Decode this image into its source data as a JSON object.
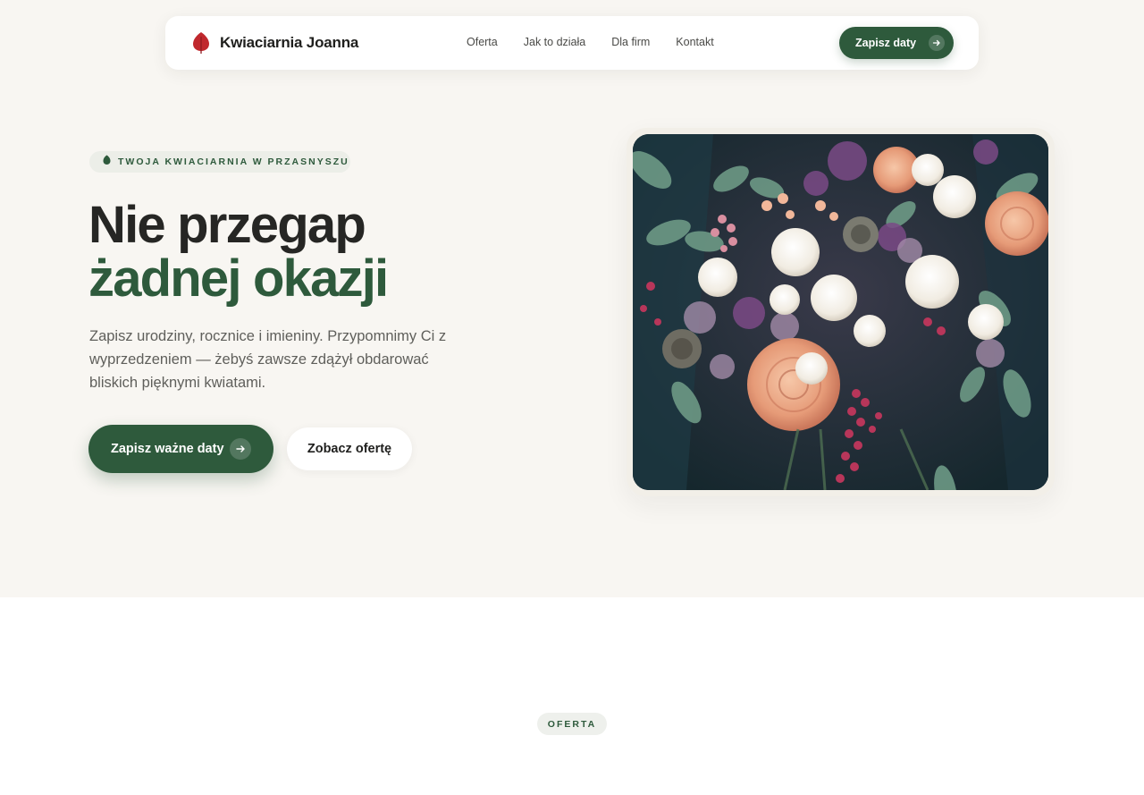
{
  "brand": {
    "name": "Kwiaciarnia Joanna",
    "logo_icon": "leaf-logo-icon",
    "logo_color": "#c0282d"
  },
  "nav": {
    "links": [
      "Oferta",
      "Jak to działa",
      "Dla firm",
      "Kontakt"
    ],
    "cta_label": "Zapisz daty"
  },
  "hero": {
    "eyebrow": "TWOJA KWIACIARNIA W PRZASNYSZU",
    "title_line1": "Nie przegap",
    "title_line2": "żadnej okazji",
    "lead": "Zapisz urodziny, rocznice i imieniny. Przypomnimy Ci z wyprzedzeniem — żebyś zawsze zdążył obdarować bliskich pięknymi kwiatami.",
    "primary_button": "Zapisz ważne daty",
    "secondary_button": "Zobacz ofertę"
  },
  "section": {
    "label": "OFERTA"
  },
  "colors": {
    "accent": "#2e5a3c",
    "hero_bg": "#f8f6f2",
    "text": "#262624"
  }
}
